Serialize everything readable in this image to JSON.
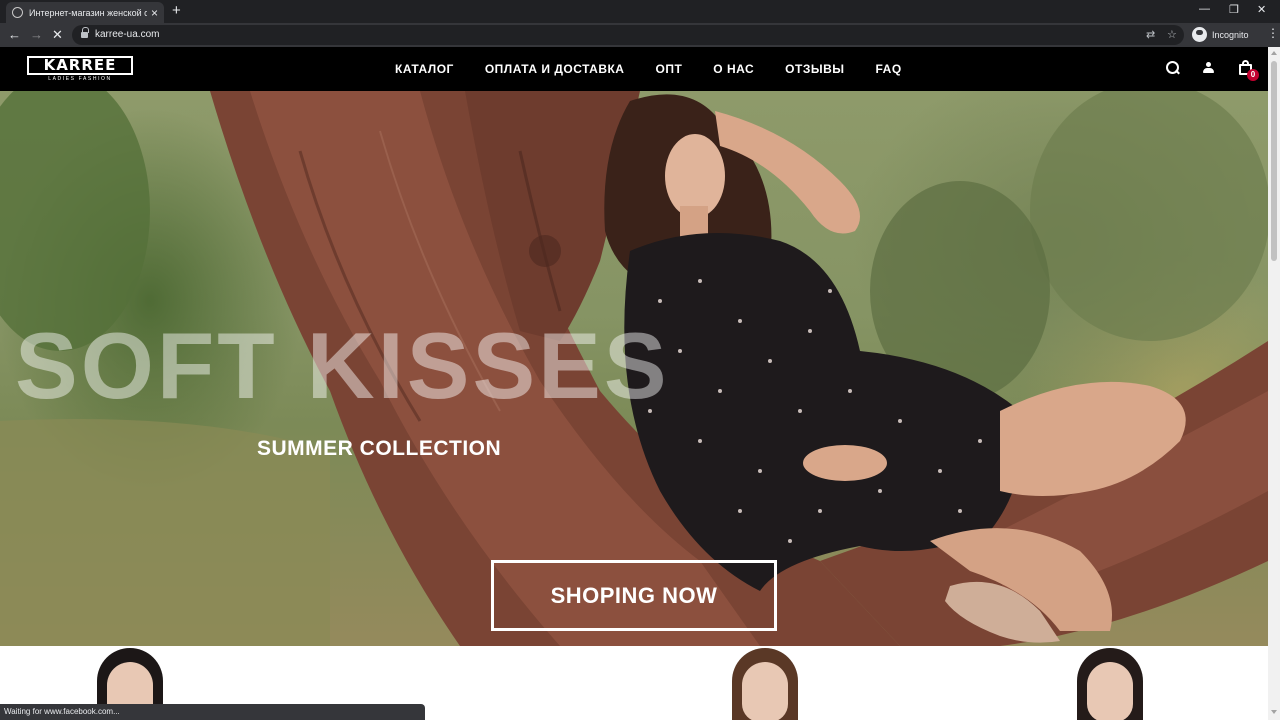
{
  "browser": {
    "tab_title": "Интернет-магазин женской од",
    "url": "karree-ua.com",
    "profile_label": "Incognito",
    "status_text": "Waiting for www.facebook.com..."
  },
  "site": {
    "logo_word": "KARRÉE",
    "logo_tagline": "LADIES FASHION",
    "nav": [
      {
        "label": "КАТАЛОГ"
      },
      {
        "label": "ОПЛАТА И ДОСТАВКА"
      },
      {
        "label": "ОПТ"
      },
      {
        "label": "О НАС"
      },
      {
        "label": "ОТЗЫВЫ"
      },
      {
        "label": "FAQ"
      }
    ],
    "cart_count": "0",
    "icons": [
      "search-icon",
      "user-icon",
      "shopping-bag-icon"
    ]
  },
  "hero": {
    "title": "SOFT KISSES",
    "subtitle": "SUMMER COLLECTION",
    "cta_label": "SHOPING NOW"
  },
  "colors": {
    "header_bg": "#000000",
    "cart_badge": "#c2002f",
    "browser_frame": "#202124"
  }
}
